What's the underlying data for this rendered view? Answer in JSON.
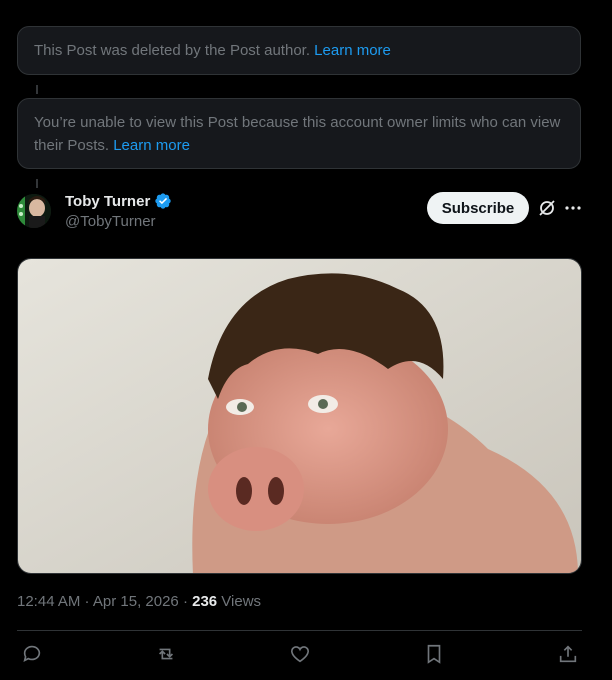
{
  "notices": [
    {
      "text": "This Post was deleted by the Post author. ",
      "link": "Learn more"
    },
    {
      "text": "You’re unable to view this Post because this account owner limits who can view their Posts. ",
      "link": "Learn more"
    }
  ],
  "post": {
    "author_name": "Toby Turner",
    "author_handle": "@TobyTurner",
    "verified_icon": "verified-badge-icon",
    "subscribe_label": "Subscribe",
    "time": "12:44 AM · Apr 15, 2026 · ",
    "views_count": "236",
    "views_label": " Views"
  },
  "actions": [
    "reply-icon",
    "repost-icon",
    "like-icon",
    "bookmark-icon",
    "share-icon"
  ],
  "colors": {
    "link": "#1d9bf0",
    "background": "#000000",
    "verified": "#1d9bf0"
  }
}
